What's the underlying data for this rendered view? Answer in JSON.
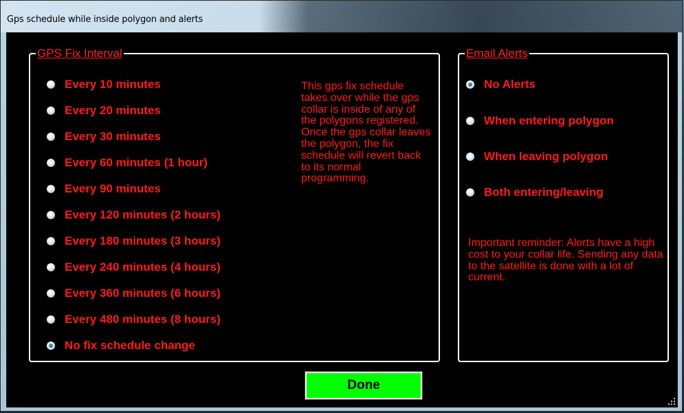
{
  "window": {
    "title": "Gps schedule while inside polygon and alerts"
  },
  "gps_group": {
    "legend": "GPS Fix Interval",
    "options": [
      {
        "label": "Every 10 minutes",
        "checked": false
      },
      {
        "label": "Every 20 minutes",
        "checked": false
      },
      {
        "label": "Every 30 minutes",
        "checked": false
      },
      {
        "label": "Every 60 minutes (1 hour)",
        "checked": false
      },
      {
        "label": "Every 90 minutes",
        "checked": false
      },
      {
        "label": "Every 120 minutes (2 hours)",
        "checked": false
      },
      {
        "label": "Every 180 minutes (3 hours)",
        "checked": false
      },
      {
        "label": "Every 240 minutes (4 hours)",
        "checked": false
      },
      {
        "label": "Every 360 minutes (6 hours)",
        "checked": false
      },
      {
        "label": "Every 480 minutes (8 hours)",
        "checked": false
      },
      {
        "label": "No fix schedule change",
        "checked": true
      }
    ],
    "note": "This gps fix schedule takes over while the gps collar is inside of any of the polygons registered. Once the gps collar leaves the polygon, the fix schedule will revert back to its normal programming."
  },
  "email_group": {
    "legend": "Email Alerts",
    "options": [
      {
        "label": "No Alerts",
        "checked": true
      },
      {
        "label": "When entering polygon",
        "checked": false
      },
      {
        "label": "When leaving polygon",
        "checked": false,
        "hovered": true
      },
      {
        "label": "Both entering/leaving",
        "checked": false
      }
    ],
    "note": "Important reminder: Alerts have a high cost to your collar life. Sending any data to the satellite is done with a lot of current."
  },
  "done_button": {
    "label": "Done"
  },
  "colors": {
    "text_red": "#ff1a1a",
    "done_green": "#00ff00",
    "background": "#000000"
  }
}
